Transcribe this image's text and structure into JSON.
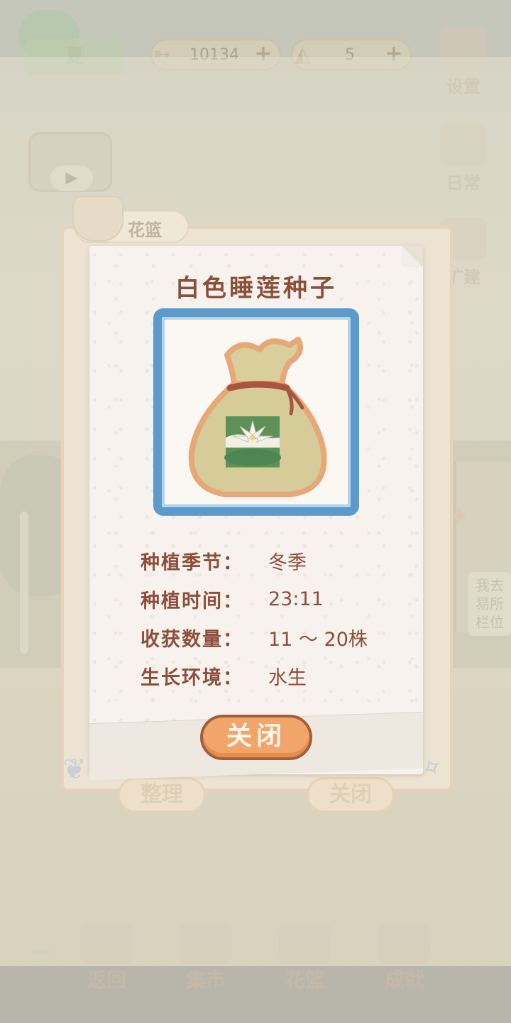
{
  "hud": {
    "season_label": "夏",
    "fish_count": "10134",
    "cheese_count": "5",
    "settings_label": "设置",
    "daily_label": "日常",
    "build_label": "扩建"
  },
  "background": {
    "side_sign_text": "我去\n易所\n栏位"
  },
  "basket_panel": {
    "tab_label": "花篮",
    "sort_button": "整理",
    "close_button": "关闭"
  },
  "bottom_nav": {
    "items": [
      {
        "label": "返回"
      },
      {
        "label": "集市"
      },
      {
        "label": "花篮"
      },
      {
        "label": "成就"
      }
    ]
  },
  "item_popup": {
    "title": "白色睡莲种子",
    "rows": [
      {
        "key": "种植季节：",
        "value": "冬季"
      },
      {
        "key": "种植时间：",
        "value": "23:11"
      },
      {
        "key": "收获数量：",
        "value": "11 ～ 20株"
      },
      {
        "key": "生长环境：",
        "value": "水生"
      }
    ],
    "close_button": "关闭"
  },
  "colors": {
    "title_text": "#8b4f3a",
    "frame_blue": "#5b9acb",
    "close_button_fill": "#f1a56a",
    "close_button_border": "#a25f3c"
  },
  "icons": [
    "fish-icon",
    "cheese-icon",
    "gear-icon",
    "play-icon",
    "basket-icon",
    "seed-bag-icon",
    "water-lily-icon",
    "butterfly-icon",
    "dragonfly-icon",
    "arrow-right-icon"
  ]
}
